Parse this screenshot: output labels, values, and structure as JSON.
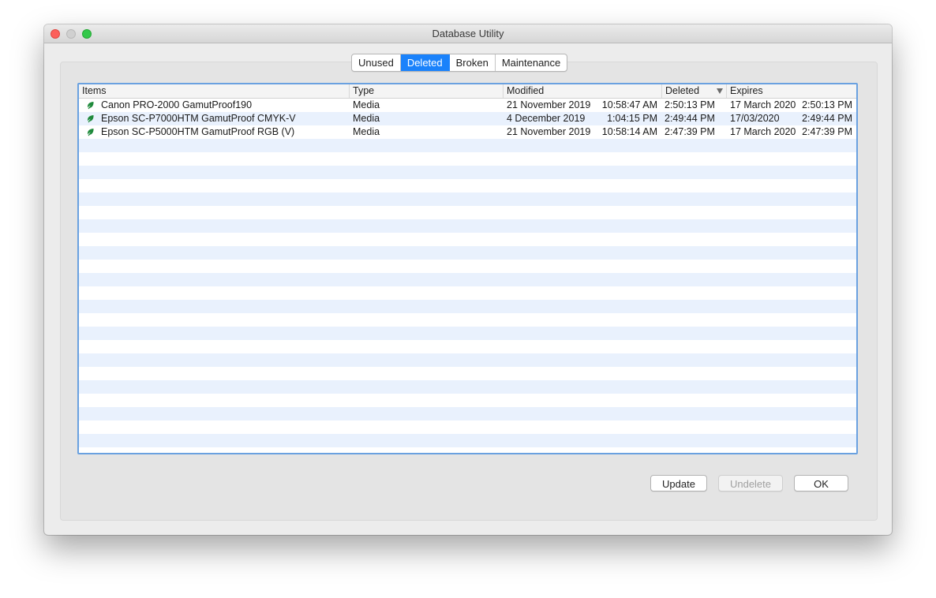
{
  "window": {
    "title": "Database Utility"
  },
  "tabs": [
    {
      "label": "Unused",
      "active": false
    },
    {
      "label": "Deleted",
      "active": true
    },
    {
      "label": "Broken",
      "active": false
    },
    {
      "label": "Maintenance",
      "active": false
    }
  ],
  "table": {
    "columns": [
      "Items",
      "Type",
      "Modified",
      "Deleted",
      "Expires"
    ],
    "sort_column": "Deleted",
    "rows": [
      {
        "icon": "leaf-icon",
        "item": "Canon PRO-2000 GamutProof190",
        "type": "Media",
        "modified_date": "21 November 2019",
        "modified_time": "10:58:47 AM",
        "deleted": "2:50:13 PM",
        "expires_date": "17 March 2020",
        "expires_time": "2:50:13 PM"
      },
      {
        "icon": "leaf-icon",
        "item": "Epson SC-P7000HTM GamutProof CMYK-V",
        "type": "Media",
        "modified_date": "4 December 2019",
        "modified_time": "1:04:15 PM",
        "deleted": "2:49:44 PM",
        "expires_date": "17/03/2020",
        "expires_time": "2:49:44 PM"
      },
      {
        "icon": "leaf-icon",
        "item": "Epson SC-P5000HTM GamutProof RGB (V)",
        "type": "Media",
        "modified_date": "21 November 2019",
        "modified_time": "10:58:14 AM",
        "deleted": "2:47:39 PM",
        "expires_date": "17 March 2020",
        "expires_time": "2:47:39 PM"
      }
    ]
  },
  "buttons": {
    "update": "Update",
    "undelete": "Undelete",
    "ok": "OK"
  },
  "colors": {
    "accent": "#1a82fb",
    "leaf": "#1f8a3c",
    "stripe": "#e9f1fd"
  }
}
